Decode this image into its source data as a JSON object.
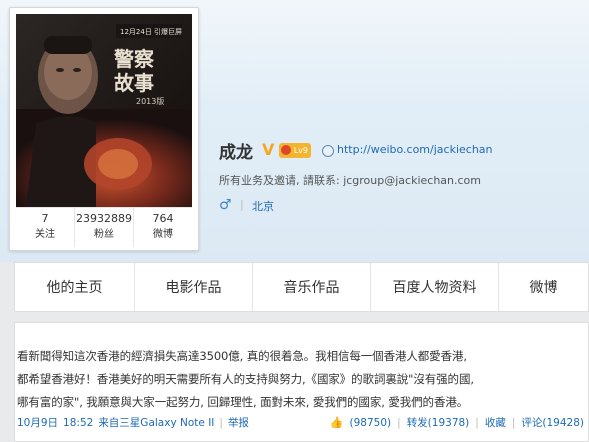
{
  "profile": {
    "name": "成龙",
    "verified_icon": "V",
    "vip_badge": "Lv9",
    "url": "http://weibo.com/jackiechan",
    "description": "所有业务及邀请, 請联系: jcgroup@jackiechan.com",
    "gender_icon": "♂",
    "location": "北京",
    "avatar": {
      "poster_date": "12月24日 引爆巨屏",
      "poster_title": "警察故事",
      "poster_subtitle": "2013版"
    }
  },
  "stats": [
    {
      "value": "7",
      "label": "关注"
    },
    {
      "value": "23932889",
      "label": "粉丝"
    },
    {
      "value": "764",
      "label": "微博"
    }
  ],
  "nav": {
    "tabs": [
      {
        "label": "他的主页"
      },
      {
        "label": "电影作品"
      },
      {
        "label": "音乐作品"
      },
      {
        "label": "百度人物资料"
      },
      {
        "label": "微博"
      }
    ]
  },
  "post": {
    "lines": [
      "看新聞得知這次香港的經濟損失高達3500億, 真的很着急。我相信每一個香港人都愛香港,",
      "都希望香港好！香港美好的明天需要所有人的支持與努力,《國家》的歌詞裏說\"沒有强的國,",
      "哪有富的家\", 我願意與大家一起努力, 回歸理性, 面對未來, 愛我們的國家, 愛我們的香港。"
    ],
    "date": "10月9日",
    "time": "18:52",
    "source": "来自三星Galaxy Note II",
    "report": "举报",
    "likes": "(98750)",
    "repost_label": "转发(19378)",
    "favorite_label": "收藏",
    "comment_label": "评论(19428)"
  }
}
